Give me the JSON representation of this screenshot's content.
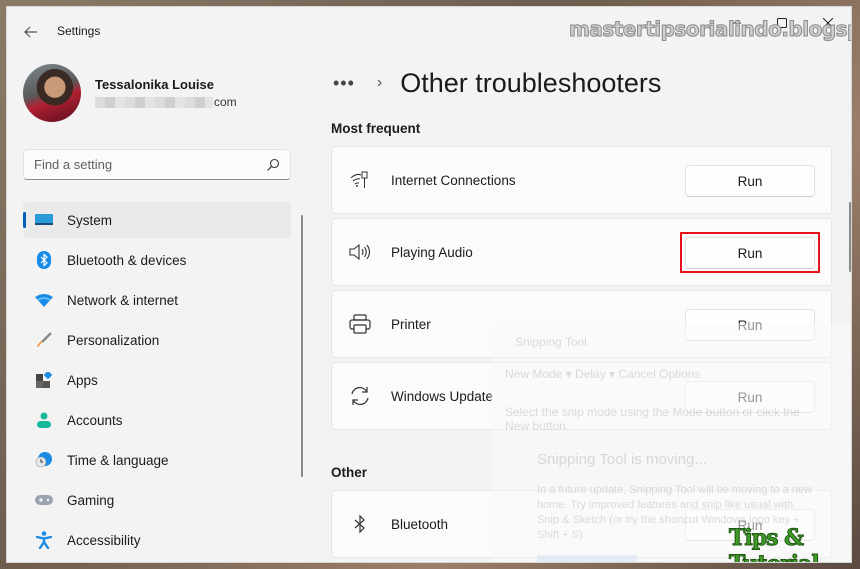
{
  "window": {
    "app_title": "Settings",
    "controls": {
      "minimize": "minimize-icon",
      "maximize": "maximize-icon",
      "close": "close-icon"
    }
  },
  "profile": {
    "name": "Tessalonika Louise",
    "email_suffix": "com"
  },
  "search": {
    "placeholder": "Find a setting",
    "value": ""
  },
  "sidebar": {
    "items": [
      {
        "label": "System",
        "icon": "system-icon",
        "active": true
      },
      {
        "label": "Bluetooth & devices",
        "icon": "bluetooth-icon",
        "active": false
      },
      {
        "label": "Network & internet",
        "icon": "wifi-icon",
        "active": false
      },
      {
        "label": "Personalization",
        "icon": "brush-icon",
        "active": false
      },
      {
        "label": "Apps",
        "icon": "apps-icon",
        "active": false
      },
      {
        "label": "Accounts",
        "icon": "person-icon",
        "active": false
      },
      {
        "label": "Time & language",
        "icon": "globe-clock-icon",
        "active": false
      },
      {
        "label": "Gaming",
        "icon": "gamepad-icon",
        "active": false
      },
      {
        "label": "Accessibility",
        "icon": "accessibility-icon",
        "active": false
      }
    ]
  },
  "breadcrumb": {
    "more": "•••",
    "separator": "›",
    "title": "Other troubleshooters"
  },
  "sections": [
    {
      "title": "Most frequent",
      "items": [
        {
          "label": "Internet Connections",
          "icon": "wifi-ethernet-icon",
          "button": "Run"
        },
        {
          "label": "Playing Audio",
          "icon": "speaker-icon",
          "button": "Run",
          "highlighted": true
        },
        {
          "label": "Printer",
          "icon": "printer-icon",
          "button": "Run"
        },
        {
          "label": "Windows Update",
          "icon": "sync-icon",
          "button": "Run"
        }
      ]
    },
    {
      "title": "Other",
      "items": [
        {
          "label": "Bluetooth",
          "icon": "bluetooth-icon",
          "button": "Run"
        }
      ]
    }
  ],
  "ghost_overlay": {
    "title": "Snipping Tool",
    "toolbar": "New   Mode ▾   Delay ▾   Cancel   Options",
    "description": "Select the snip mode using the Mode button or click the New button.",
    "heading": "Snipping Tool is moving...",
    "body": "In a future update, Snipping Tool will be moving to a new home. Try improved features and snip like usual with Snip & Sketch (or try the shortcut Windows logo key + Shift + S)."
  },
  "watermarks": {
    "top": "mastertipsorialindo.blogspot.com",
    "bottom": "Tips & Tutorial"
  }
}
